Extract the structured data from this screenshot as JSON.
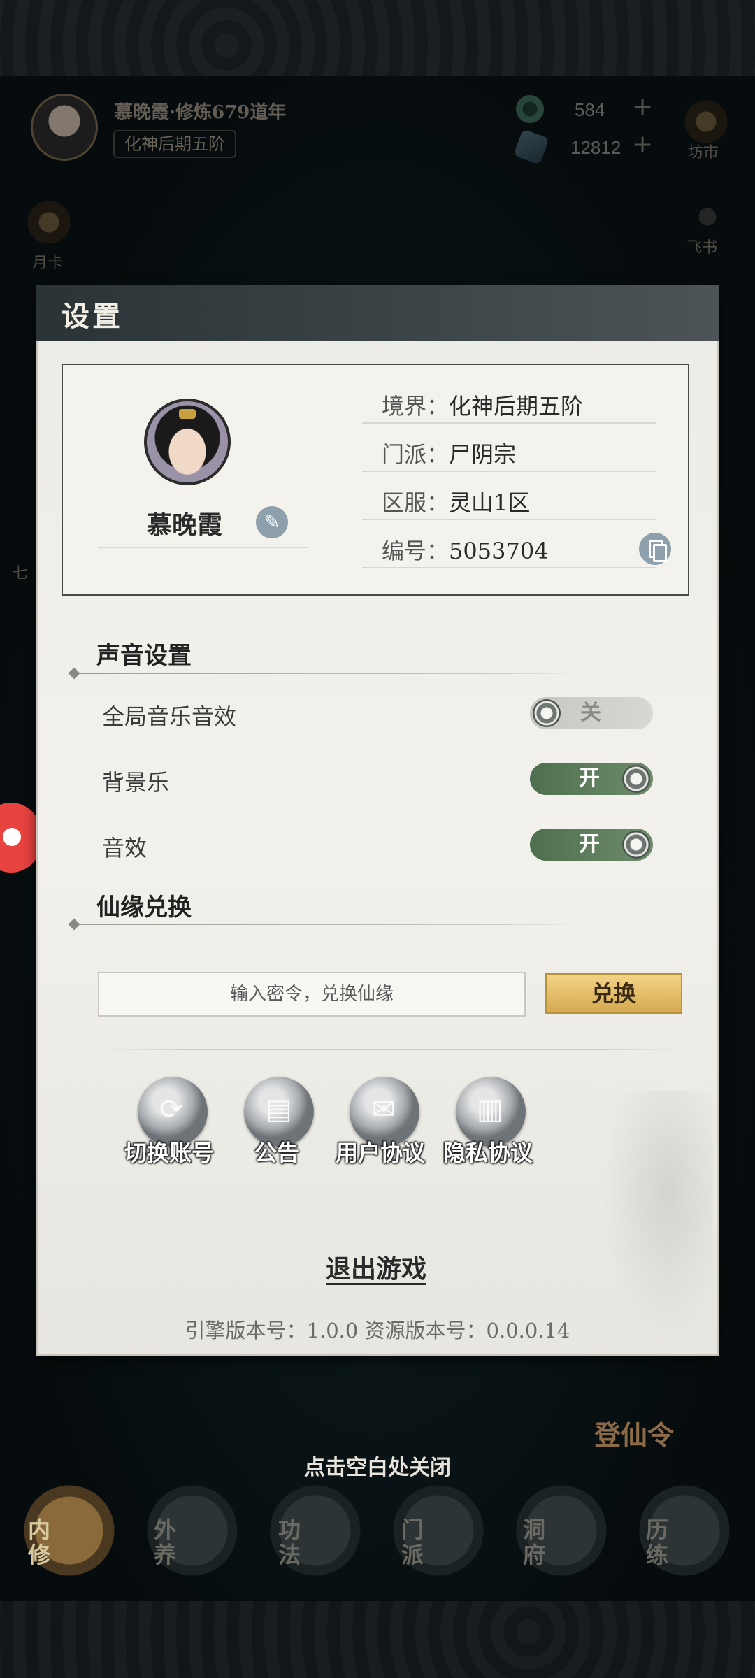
{
  "hud": {
    "player_line": "慕晚霞·修炼679道年",
    "realm_badge": "化神后期五阶",
    "currency_jade": "584",
    "currency_stone": "12812",
    "plus": "+",
    "market_label": "坊市",
    "monthly_card_label": "月卡",
    "letter_label": "飞书",
    "seven_label": "七"
  },
  "settings": {
    "title": "设置",
    "profile": {
      "name": "慕晚霞",
      "rows": [
        {
          "label": "境界：",
          "value": "化神后期五阶"
        },
        {
          "label": "门派：",
          "value": "尸阴宗"
        },
        {
          "label": "区服：",
          "value": "灵山1区"
        },
        {
          "label": "编号：",
          "value": "5053704"
        }
      ]
    },
    "sound": {
      "title": "声音设置",
      "items": [
        {
          "label": "全局音乐音效",
          "state": "关"
        },
        {
          "label": "背景乐",
          "state": "开"
        },
        {
          "label": "音效",
          "state": "开"
        }
      ]
    },
    "redeem": {
      "title": "仙缘兑换",
      "placeholder": "输入密令，兑换仙缘",
      "button": "兑换"
    },
    "actions": [
      {
        "label": "切换账号",
        "icon": "swap-account-icon"
      },
      {
        "label": "公告",
        "icon": "scroll-notice-icon"
      },
      {
        "label": "用户协议",
        "icon": "rolled-scroll-icon"
      },
      {
        "label": "隐私协议",
        "icon": "open-book-icon"
      }
    ],
    "exit": "退出游戏",
    "version": "引擎版本号：1.0.0 资源版本号：0.0.0.14"
  },
  "overlay": {
    "close_hint": "点击空白处关闭",
    "dengxianling": "登仙令"
  },
  "bottom_nav": [
    {
      "label": "内修",
      "active": true
    },
    {
      "label": "外养",
      "active": false
    },
    {
      "label": "功法",
      "active": false
    },
    {
      "label": "门派",
      "active": false
    },
    {
      "label": "洞府",
      "active": false
    },
    {
      "label": "历练",
      "active": false
    }
  ],
  "colors": {
    "toggle_on": "#5e7f5c",
    "toggle_off": "#cfcec9",
    "redeem_button": "#e6c16a",
    "header_dark": "#2f383b"
  }
}
